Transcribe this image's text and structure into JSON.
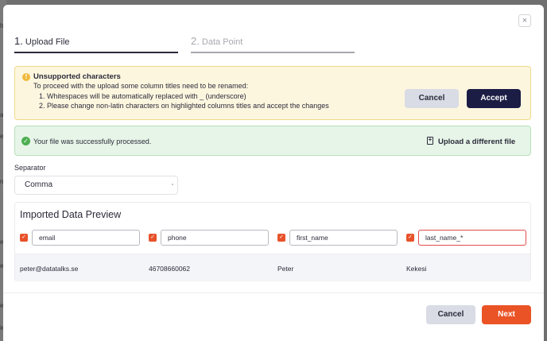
{
  "background": {
    "letters": [
      "h",
      "al",
      "e",
      "n",
      "er",
      "es",
      "e",
      "ie"
    ]
  },
  "modal": {
    "close_glyph": "×",
    "steps": [
      {
        "number": "1.",
        "label": "Upload File",
        "state": "active"
      },
      {
        "number": "2.",
        "label": "Data Point",
        "state": "inactive"
      }
    ],
    "warning": {
      "title": "Unsupported characters",
      "description": "To proceed with the upload some column titles need to be renamed:",
      "items": [
        "1. Whitespaces will be automatically replaced with _ (underscore)",
        "2. Please change non-latin characters on highlighted columns titles and accept the changes"
      ],
      "cancel_label": "Cancel",
      "accept_label": "Accept"
    },
    "success": {
      "message": "Your file was successfully processed.",
      "upload_label": "Upload a different file"
    },
    "separator": {
      "label": "Separator",
      "value": "Comma"
    },
    "preview": {
      "title": "Imported Data Preview",
      "columns": [
        "email",
        "phone",
        "first_name",
        "last_name_*"
      ],
      "rows": [
        [
          "peter@datatalks.se",
          "46708660062",
          "Peter",
          "Kekesi"
        ]
      ]
    },
    "footer": {
      "cancel_label": "Cancel",
      "next_label": "Next"
    }
  },
  "colors": {
    "accent": "#ea5325",
    "primary_dark": "#1c1d45",
    "warning_bg": "#fdf6df",
    "success_bg": "#e7f5e8",
    "error_border": "#e34b4b"
  }
}
